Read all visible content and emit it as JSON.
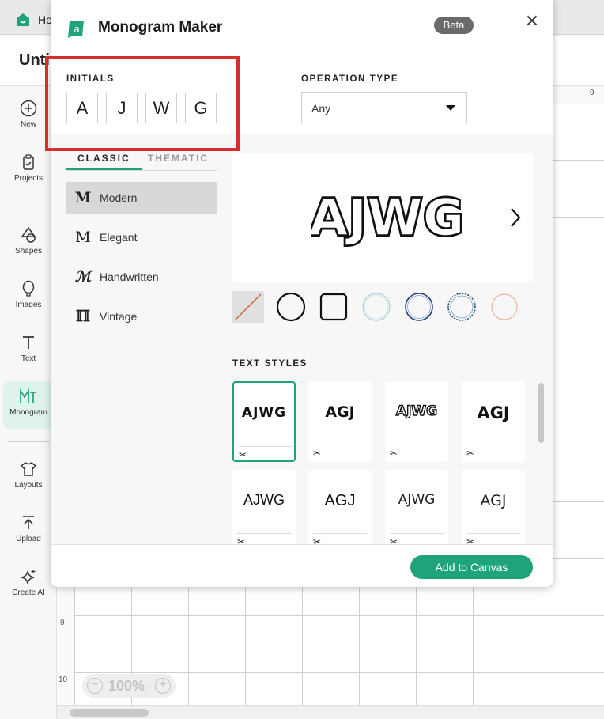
{
  "app": {
    "home_label": "Ho",
    "document_title": "Unti",
    "rail": [
      {
        "label": "New",
        "icon": "plus-circle-icon"
      },
      {
        "label": "Projects",
        "icon": "clipboard-icon"
      },
      {
        "label": "Shapes",
        "icon": "shapes-icon"
      },
      {
        "label": "Images",
        "icon": "balloon-icon"
      },
      {
        "label": "Text",
        "icon": "text-icon"
      },
      {
        "label": "Monogram",
        "icon": "monogram-icon"
      },
      {
        "label": "Layouts",
        "icon": "tshirt-icon"
      },
      {
        "label": "Upload",
        "icon": "upload-icon"
      },
      {
        "label": "Create AI",
        "icon": "sparkle-icon"
      }
    ],
    "ruler": {
      "top": "9",
      "left_a": "9",
      "left_b": "10"
    },
    "zoom": {
      "value": "100%",
      "minus": "−",
      "plus": "+"
    },
    "accent_color": "#1fa37a"
  },
  "modal": {
    "title": "Monogram Maker",
    "badge": "Beta",
    "close": "✕",
    "initials_label": "INITIALS",
    "initials": [
      "A",
      "J",
      "W",
      "G"
    ],
    "operation_label": "OPERATION TYPE",
    "operation_value": "Any",
    "tabs": [
      {
        "label": "CLASSIC"
      },
      {
        "label": "THEMATIC"
      }
    ],
    "styles": [
      {
        "icon_glyph": "M",
        "label": "Modern"
      },
      {
        "icon_glyph": "M",
        "label": "Elegant"
      },
      {
        "icon_glyph": "ℳ",
        "label": "Handwritten"
      },
      {
        "icon_glyph": "ℿ",
        "label": "Vintage"
      }
    ],
    "selected_style": "Modern",
    "preview_text": "AJWG",
    "frames": [
      "none",
      "circle",
      "square",
      "circle-light-teal",
      "circle-navy",
      "circle-dotted",
      "circle-peach"
    ],
    "text_styles_label": "TEXT STYLES",
    "text_styles": [
      {
        "text": "AJWG"
      },
      {
        "text": "AGJ"
      },
      {
        "text": "AJWG"
      },
      {
        "text": "AGJ"
      },
      {
        "text": "AJWG"
      },
      {
        "text": "AGJ"
      },
      {
        "text": "AJWG"
      },
      {
        "text": "AGJ"
      }
    ],
    "cut_icon": "✂",
    "add_button": "Add to Canvas"
  }
}
